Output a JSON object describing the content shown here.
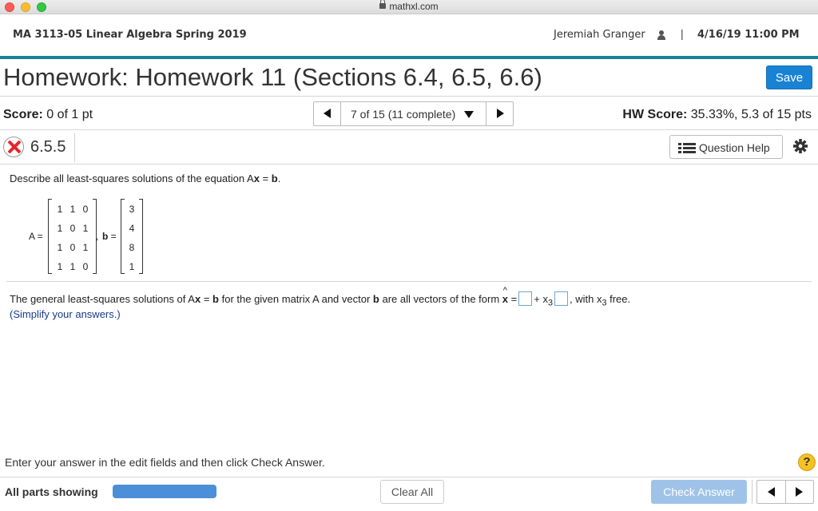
{
  "browser": {
    "url": "mathxl.com"
  },
  "header": {
    "course": "MA 3113-05 Linear Algebra Spring 2019",
    "user": "Jeremiah Granger",
    "separator": "|",
    "due": "4/16/19 11:00 PM"
  },
  "homework": {
    "title": "Homework: Homework 11 (Sections 6.4, 6.5, 6.6)",
    "save_label": "Save"
  },
  "score": {
    "label": "Score:",
    "value": "0 of 1 pt"
  },
  "navigation": {
    "label": "7 of 15 (11 complete)"
  },
  "hw_score": {
    "label": "HW Score:",
    "value": "35.33%, 5.3 of 15 pts"
  },
  "question": {
    "number": "6.5.5",
    "help_label": "Question Help",
    "prompt_text": "Describe all least-squares solutions of the equation A",
    "prompt_x": "x",
    "prompt_eq": " = ",
    "prompt_b": "b",
    "prompt_end": "."
  },
  "matrix": {
    "a_label": "A =",
    "b_label": "b",
    "b_eq": " =",
    "comma": ",",
    "A": [
      [
        "1",
        "1",
        "0"
      ],
      [
        "1",
        "0",
        "1"
      ],
      [
        "1",
        "0",
        "1"
      ],
      [
        "1",
        "1",
        "0"
      ]
    ],
    "b": [
      "3",
      "4",
      "8",
      "1"
    ]
  },
  "answer": {
    "part1": "The general least-squares solutions of A",
    "x": "x",
    "eq": " = ",
    "b": "b",
    "part2": " for the given matrix A and vector ",
    "part3": " are all vectors of the form ",
    "xhat": "x",
    "eq2": " =",
    "plus": "+ x",
    "sub3": "3",
    "with": ", with x",
    "free": " free.",
    "simplify": "(Simplify your answers.)"
  },
  "footer": {
    "instruction": "Enter your answer in the edit fields and then click Check Answer.",
    "help_glyph": "?",
    "parts_label": "All parts showing",
    "progress": 1.0,
    "clear_label": "Clear All",
    "check_label": "Check Answer"
  },
  "colors": {
    "accent": "#1a8199",
    "primary": "#1a82d2",
    "incorrect": "#e4262a"
  }
}
